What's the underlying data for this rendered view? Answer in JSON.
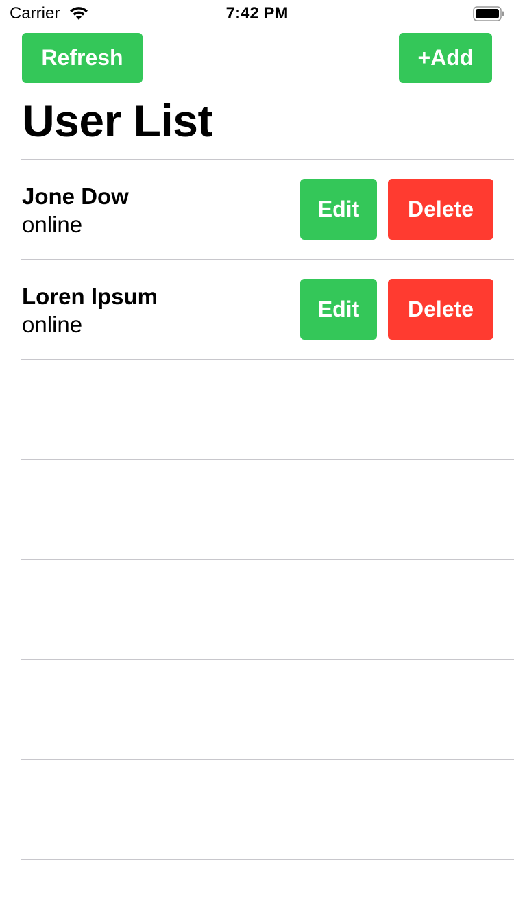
{
  "status_bar": {
    "carrier": "Carrier",
    "time": "7:42 PM",
    "wifi_icon": "wifi-icon",
    "battery_icon": "battery-icon"
  },
  "toolbar": {
    "refresh_label": "Refresh",
    "add_label": "+Add"
  },
  "page": {
    "title": "User List"
  },
  "users": [
    {
      "name": "Jone Dow",
      "status": "online",
      "edit_label": "Edit",
      "delete_label": "Delete"
    },
    {
      "name": "Loren Ipsum",
      "status": "online",
      "edit_label": "Edit",
      "delete_label": "Delete"
    }
  ],
  "colors": {
    "green": "#34c759",
    "red": "#ff3b30",
    "separator": "#c8c7cc"
  }
}
